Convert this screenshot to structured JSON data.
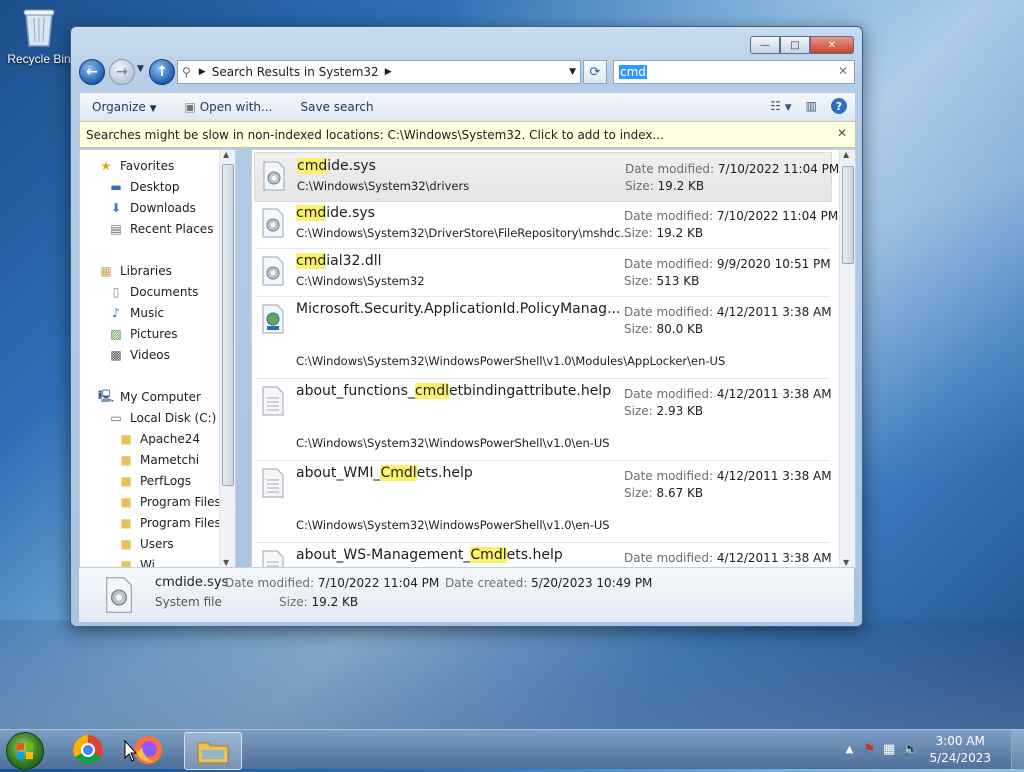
{
  "desktop": {
    "recycle_bin_label": "Recycle Bin"
  },
  "window": {
    "caption_buttons": {
      "minimize": "—",
      "maximize": "□",
      "close": "✕"
    },
    "address": {
      "breadcrumb": "Search Results in System32"
    },
    "search": {
      "value": "cmd"
    },
    "toolbar": {
      "organize": "Organize",
      "open_with": "Open with...",
      "save_search": "Save search"
    },
    "infobar": {
      "message": "Searches might be slow in non-indexed locations: C:\\Windows\\System32. Click to add to index..."
    },
    "nav": {
      "favorites": "Favorites",
      "favorites_items": [
        "Desktop",
        "Downloads",
        "Recent Places"
      ],
      "libraries": "Libraries",
      "libraries_items": [
        "Documents",
        "Music",
        "Pictures",
        "Videos"
      ],
      "computer": "My Computer",
      "local_disk": "Local Disk (C:)",
      "folders": [
        "Apache24",
        "Mametchi",
        "PerfLogs",
        "Program Files",
        "Program Files (",
        "Users",
        "Wi..."
      ]
    },
    "results": [
      {
        "pre": "",
        "hl": "cmd",
        "post": "ide.sys",
        "path": "C:\\Windows\\System32\\drivers",
        "date_label": "Date modified:",
        "date": "7/10/2022 11:04 PM",
        "size_label": "Size:",
        "size": "19.2 KB"
      },
      {
        "pre": "",
        "hl": "cmd",
        "post": "ide.sys",
        "path": "C:\\Windows\\System32\\DriverStore\\FileRepository\\mshdc...",
        "date_label": "Date modified:",
        "date": "7/10/2022 11:04 PM",
        "size_label": "Size:",
        "size": "19.2 KB"
      },
      {
        "pre": "",
        "hl": "cmd",
        "post": "ial32.dll",
        "path": "C:\\Windows\\System32",
        "date_label": "Date modified:",
        "date": "9/9/2020 10:51 PM",
        "size_label": "Size:",
        "size": "513 KB"
      },
      {
        "pre": "Microsoft.Security.ApplicationId.PolicyManag...",
        "hl": "",
        "post": "",
        "path": "C:\\Windows\\System32\\WindowsPowerShell\\v1.0\\Modules\\AppLocker\\en-US",
        "date_label": "Date modified:",
        "date": "4/12/2011 3:38 AM",
        "size_label": "Size:",
        "size": "80.0 KB"
      },
      {
        "pre": "about_functions_",
        "hl": "cmdl",
        "post": "etbindingattribute.help",
        "path": "C:\\Windows\\System32\\WindowsPowerShell\\v1.0\\en-US",
        "date_label": "Date modified:",
        "date": "4/12/2011 3:38 AM",
        "size_label": "Size:",
        "size": "2.93 KB"
      },
      {
        "pre": "about_WMI_",
        "hl": "Cmdl",
        "post": "ets.help",
        "path": "C:\\Windows\\System32\\WindowsPowerShell\\v1.0\\en-US",
        "date_label": "Date modified:",
        "date": "4/12/2011 3:38 AM",
        "size_label": "Size:",
        "size": "8.67 KB"
      },
      {
        "pre": "about_WS-Management_",
        "hl": "Cmdl",
        "post": "ets.help",
        "path": "",
        "date_label": "Date modified:",
        "date": "4/12/2011 3:38 AM",
        "size_label": "",
        "size": ""
      }
    ],
    "details": {
      "name": "cmdide.sys",
      "type": "System file",
      "modified_label": "Date modified:",
      "modified": "7/10/2022 11:04 PM",
      "created_label": "Date created:",
      "created": "5/20/2023 10:49 PM",
      "size_label": "Size:",
      "size": "19.2 KB"
    }
  },
  "taskbar": {
    "time": "3:00 AM",
    "date": "5/24/2023"
  }
}
